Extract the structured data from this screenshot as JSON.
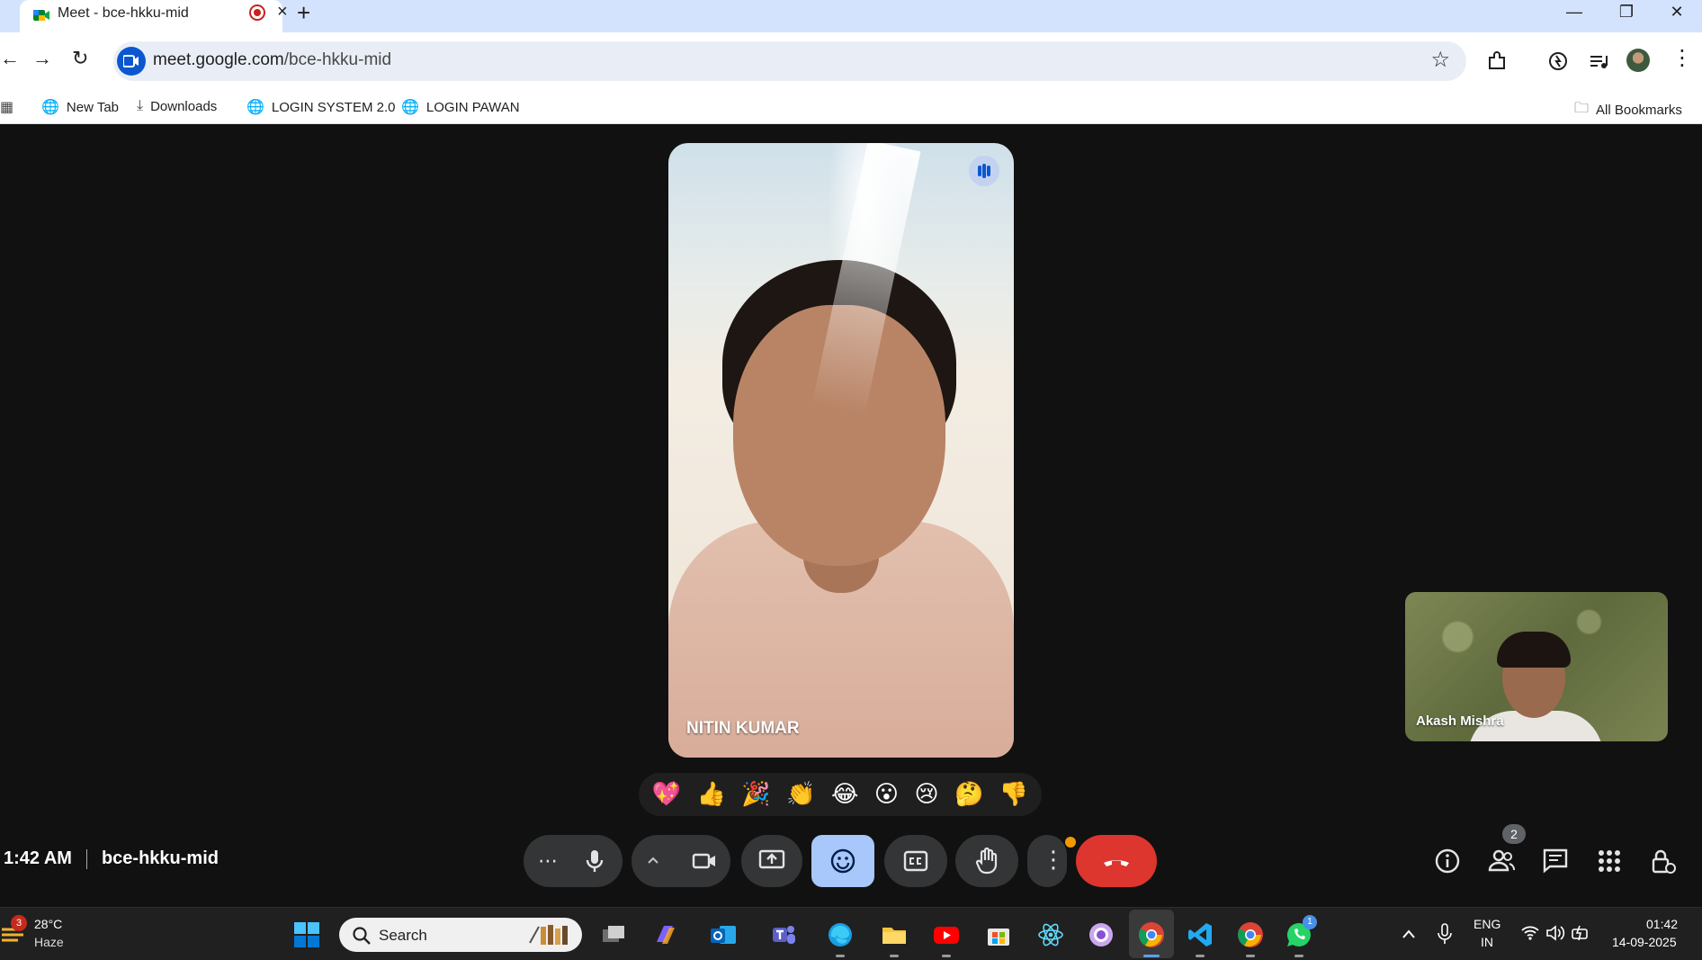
{
  "browser": {
    "tab_title": "Meet - bce-hkku-mid",
    "url_host": "meet.google.com",
    "url_path": "/bce-hkku-mid",
    "bookmarks": [
      {
        "label": "New Tab",
        "icon": "globe-icon"
      },
      {
        "label": "Downloads",
        "icon": "download-icon"
      },
      {
        "label": "LOGIN SYSTEM 2.0",
        "icon": "globe-icon"
      },
      {
        "label": "LOGIN PAWAN",
        "icon": "globe-icon"
      }
    ],
    "all_bookmarks_label": "All Bookmarks"
  },
  "meet": {
    "main_participant": "NITIN KUMAR",
    "self_participant": "Akash Mishra",
    "time": "1:42 AM",
    "meeting_code": "bce-hkku-mid",
    "reactions": [
      "💖",
      "👍",
      "🎉",
      "👏",
      "😂",
      "😮",
      "😢",
      "🤔",
      "👎"
    ],
    "people_count": "2",
    "controls": [
      "more-options",
      "microphone",
      "camera-options",
      "camera",
      "present",
      "emoji",
      "captions",
      "raise-hand",
      "more",
      "leave-call"
    ],
    "accent": "#a8c7fa",
    "end_call_color": "#dc362e"
  },
  "taskbar": {
    "weather_badge": "3",
    "temperature": "28°C",
    "condition": "Haze",
    "search_placeholder": "Search",
    "whatsapp_badge": "1",
    "lang_line1": "ENG",
    "lang_line2": "IN",
    "clock_time": "01:42",
    "clock_date": "14-09-2025"
  }
}
